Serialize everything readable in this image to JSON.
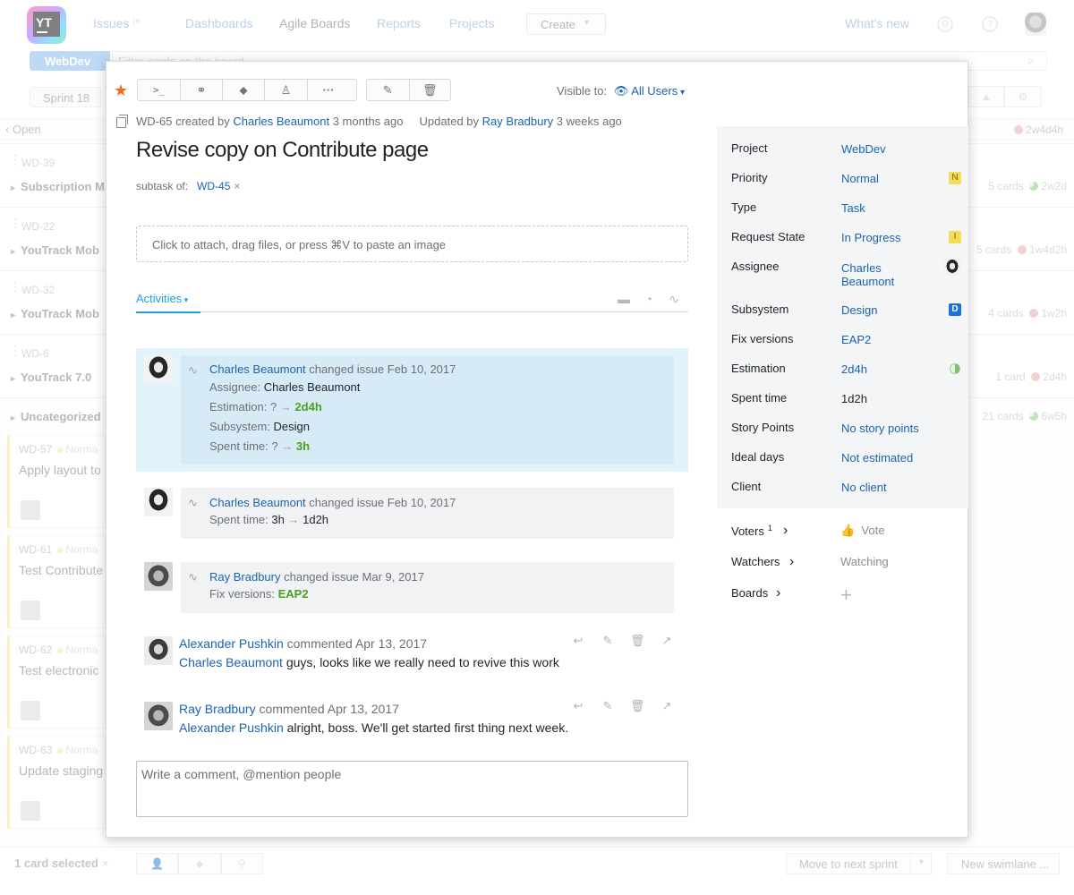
{
  "topnav": {
    "logo_text": "YT",
    "items": [
      "Issues",
      "Dashboards",
      "Agile Boards",
      "Reports",
      "Projects"
    ],
    "create": "Create",
    "whats_new": "What's new"
  },
  "board": {
    "project": "WebDev",
    "filter_placeholder": "Filter cards on the board",
    "sprint": "Sprint 18",
    "column": "Open",
    "column_time": "2w4d4h",
    "swimlanes": [
      {
        "id": "WD-39",
        "title": "Subscription M",
        "count": "5 cards",
        "time": "2w2d"
      },
      {
        "id": "WD-22",
        "title": "YouTrack Mob",
        "count": "5 cards",
        "time": "1w4d2h"
      },
      {
        "id": "WD-32",
        "title": "YouTrack Mob",
        "count": "4 cards",
        "time": "1w2h"
      },
      {
        "id": "WD-6",
        "title": "YouTrack 7.0",
        "count": "1 card",
        "time": "2d4h"
      }
    ],
    "uncategorized": {
      "title": "Uncategorized",
      "count": "21 cards",
      "time": "6w5h"
    },
    "cards": [
      {
        "id": "WD-57",
        "priority": "Norma",
        "title": "Apply layout to"
      },
      {
        "id": "WD-61",
        "priority": "Norma",
        "title": "Test Contribute"
      },
      {
        "id": "WD-62",
        "priority": "Norma",
        "title": "Test electronic"
      },
      {
        "id": "WD-63",
        "priority": "Norma",
        "title": "Update staging"
      }
    ],
    "footer": {
      "selected": "1 card selected",
      "move": "Move to next sprint",
      "new_swimlane": "New swimlane ..."
    }
  },
  "issue": {
    "visible_label": "Visible to:",
    "visible_value": "All Users",
    "id": "WD-65",
    "created_prefix": "created by",
    "creator": "Charles Beaumont",
    "created_ago": "3 months ago",
    "updated_prefix": "Updated by",
    "updater": "Ray Bradbury",
    "updated_ago": "3 weeks ago",
    "title": "Revise copy on Contribute page",
    "subtask_label": "subtask of:",
    "subtask_parent": "WD-45",
    "attach_hint": "Click to attach, drag files, or press ⌘V to paste an image",
    "tab": "Activities",
    "comment_placeholder": "Write a comment, @mention people"
  },
  "activities": [
    {
      "author": "Charles Beaumont",
      "action": "changed issue Feb 10, 2017",
      "changes": [
        {
          "field": "Assignee:",
          "value": "Charles Beaumont"
        },
        {
          "field": "Estimation:",
          "from": "?",
          "to": "2d4h"
        },
        {
          "field": "Subsystem:",
          "value": "Design"
        },
        {
          "field": "Spent time:",
          "from": "?",
          "to": "3h"
        }
      ]
    },
    {
      "author": "Charles Beaumont",
      "action": "changed issue Feb 10, 2017",
      "changes": [
        {
          "field": "Spent time:",
          "from": "3h",
          "to": "1d2h"
        }
      ]
    },
    {
      "author": "Ray Bradbury",
      "action": "changed issue Mar 9, 2017",
      "changes": [
        {
          "field": "Fix versions:",
          "value": "EAP2"
        }
      ]
    }
  ],
  "comments": [
    {
      "author": "Alexander Pushkin",
      "action": "commented Apr 13, 2017",
      "mention": "Charles Beaumont",
      "text": "guys, looks like we really need to revive this work"
    },
    {
      "author": "Ray Bradbury",
      "action": "commented Apr 13, 2017",
      "mention": "Alexander Pushkin",
      "text": "alright, boss. We'll get started first thing next week."
    }
  ],
  "fields": [
    {
      "label": "Project",
      "value": "WebDev"
    },
    {
      "label": "Priority",
      "value": "Normal",
      "badge": "N"
    },
    {
      "label": "Type",
      "value": "Task"
    },
    {
      "label": "Request State",
      "value": "In Progress",
      "badge": "I"
    },
    {
      "label": "Assignee",
      "value_line1": "Charles",
      "value_line2": "Beaumont"
    },
    {
      "label": "Subsystem",
      "value": "Design",
      "badge": "D"
    },
    {
      "label": "Fix versions",
      "value": "EAP2"
    },
    {
      "label": "Estimation",
      "value": "2d4h",
      "progress": 0.5
    },
    {
      "label": "Spent time",
      "value": "1d2h"
    },
    {
      "label": "Story Points",
      "value": "No story points"
    },
    {
      "label": "Ideal days",
      "value": "Not estimated"
    },
    {
      "label": "Client",
      "value": "No client"
    }
  ],
  "social": {
    "voters_label": "Voters",
    "voters_count": "1",
    "vote": "Vote",
    "watchers_label": "Watchers",
    "watching": "Watching",
    "boards_label": "Boards"
  }
}
